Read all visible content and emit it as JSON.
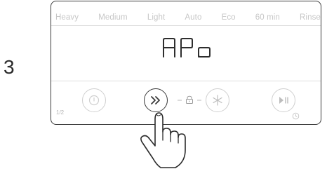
{
  "step": {
    "number": "3"
  },
  "programs": [
    "Heavy",
    "Medium",
    "Light",
    "Auto",
    "Eco",
    "60 min",
    "Rinse"
  ],
  "display": {
    "text": "APo"
  },
  "half_load": {
    "label": "1/2"
  },
  "buttons": [
    {
      "name": "power",
      "icon": "power-icon",
      "active": false
    },
    {
      "name": "program-select",
      "icon": "double-chevron-right-icon",
      "active": true
    },
    {
      "name": "extra-option",
      "icon": "star-icon",
      "active": false
    },
    {
      "name": "start-pause",
      "icon": "play-pause-icon",
      "active": false
    }
  ],
  "lock": {
    "icon": "lock-icon"
  },
  "delay": {
    "icon": "clock-icon"
  },
  "pointer": {
    "icon": "pointing-hand-icon"
  },
  "colors": {
    "active_stroke": "#3a3a3a",
    "inactive_stroke": "#cfcfcf",
    "muted_text": "#c7c7c7"
  }
}
